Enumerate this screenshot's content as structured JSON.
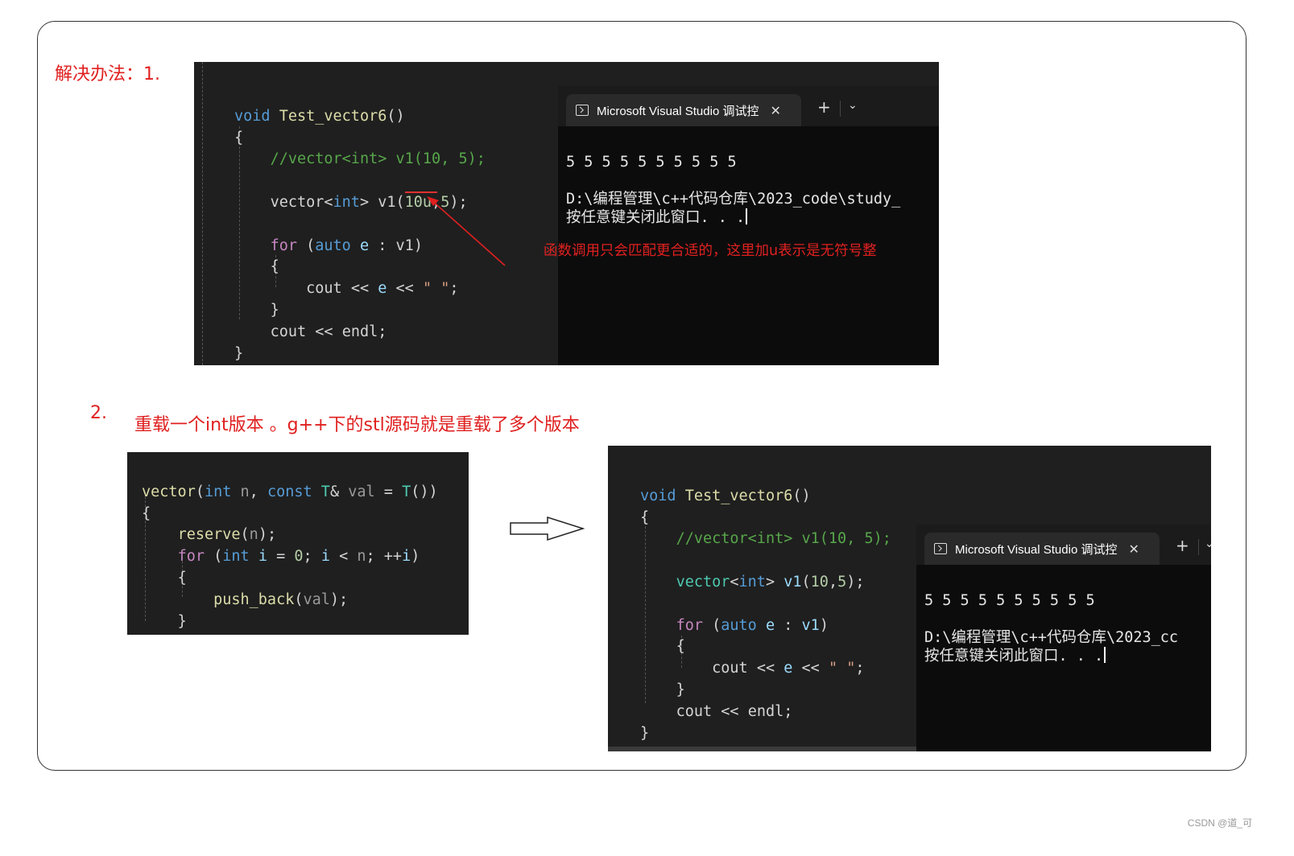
{
  "step1": {
    "label": "解决办法：1.",
    "annotation": "函数调用只会匹配更合适的，这里加u表示是无符号整",
    "code": {
      "fn_keyword": "void",
      "fn_name": "Test_vector6",
      "fn_parens": "()",
      "open_brace": "{",
      "comment": "//vector<int> v1(10, 5);",
      "decl_type": "vector",
      "decl_tmpl_open": "<",
      "decl_tmpl_type": "int",
      "decl_tmpl_close": ">",
      "decl_var": "v1",
      "decl_args_open": "(",
      "decl_arg1": "10u",
      "decl_comma": ",",
      "decl_arg2": "5",
      "decl_args_close": ");",
      "for_kw": "for",
      "for_paren_open": "(",
      "for_auto": "auto",
      "for_var": "e",
      "for_colon": ":",
      "for_range": "v1",
      "for_paren_close": ")",
      "inner_open": "{",
      "cout1": "cout",
      "op1": "<<",
      "e_var": "e",
      "op2": "<<",
      "space_str": "\" \"",
      "semi1": ";",
      "inner_close": "}",
      "cout2": "cout",
      "op3": "<<",
      "endl": "endl",
      "semi2": ";",
      "close_brace": "}"
    },
    "terminal": {
      "tab_title": "Microsoft Visual Studio 调试控",
      "close": "✕",
      "plus": "+",
      "chevron": "⌄",
      "output_line1": "5 5 5 5 5 5 5 5 5 5",
      "output_line2": "D:\\编程管理\\c++代码仓库\\2023_code\\study_",
      "output_line3": "按任意键关闭此窗口. . ."
    }
  },
  "step2": {
    "number": "2.",
    "label": "重载一个int版本 。g++下的stl源码就是重载了多个版本",
    "snippet": {
      "l1_type": "vector",
      "l1_open": "(",
      "l1_int": "int",
      "l1_n": "n",
      "l1_comma": ",",
      "l1_const": "const",
      "l1_T": "T",
      "l1_amp": "&",
      "l1_val": "val",
      "l1_eq": "=",
      "l1_T2": "T",
      "l1_close": "())",
      "l2_brace": "{",
      "l3_fn": "reserve",
      "l3_open": "(",
      "l3_n": "n",
      "l3_close": ");",
      "l4_for": "for",
      "l4_open": "(",
      "l4_int": "int",
      "l4_i": "i",
      "l4_eq": "=",
      "l4_zero": "0",
      "l4_semi": ";",
      "l4_i2": "i",
      "l4_lt": "<",
      "l4_n": "n",
      "l4_semi2": ";",
      "l4_inc": "++",
      "l4_i3": "i",
      "l4_close": ")",
      "l5_brace": "{",
      "l6_fn": "push_back",
      "l6_open": "(",
      "l6_val": "val",
      "l6_close": ");",
      "l7_brace": "}",
      "l8_brace": "}"
    },
    "code": {
      "fn_keyword": "void",
      "fn_name": "Test_vector6",
      "fn_parens": "()",
      "open_brace": "{",
      "comment": "//vector<int> v1(10, 5);",
      "decl_type": "vector",
      "decl_tmpl_open": "<",
      "decl_tmpl_type": "int",
      "decl_tmpl_close": ">",
      "decl_var": "v1",
      "decl_args_open": "(",
      "decl_arg1": "10",
      "decl_comma": ",",
      "decl_arg2": "5",
      "decl_args_close": ");",
      "for_kw": "for",
      "for_paren_open": "(",
      "for_auto": "auto",
      "for_var": "e",
      "for_colon": ":",
      "for_range": "v1",
      "for_paren_close": ")",
      "inner_open": "{",
      "cout1": "cout",
      "op1": "<<",
      "e_var": "e",
      "op2": "<<",
      "space_str": "\" \"",
      "semi1": ";",
      "inner_close": "}",
      "cout2": "cout",
      "op3": "<<",
      "endl": "endl",
      "semi2": ";",
      "close_brace": "}"
    },
    "terminal": {
      "tab_title": "Microsoft Visual Studio 调试控",
      "close": "✕",
      "plus": "+",
      "chevron": "⌄",
      "output_line1": "5 5 5 5 5 5 5 5 5 5",
      "output_line2": "D:\\编程管理\\c++代码仓库\\2023_cc",
      "output_line3": "按任意键关闭此窗口. . ."
    }
  },
  "watermark": "CSDN @道_可",
  "colors": {
    "annotation_red": "#e02020",
    "editor_bg": "#1f1f1f",
    "terminal_bg": "#0c0c0c",
    "keyword": "#569cd6",
    "comment": "#57a64a",
    "function": "#dcdcaa",
    "number": "#b5cea8",
    "string": "#d69d85"
  }
}
